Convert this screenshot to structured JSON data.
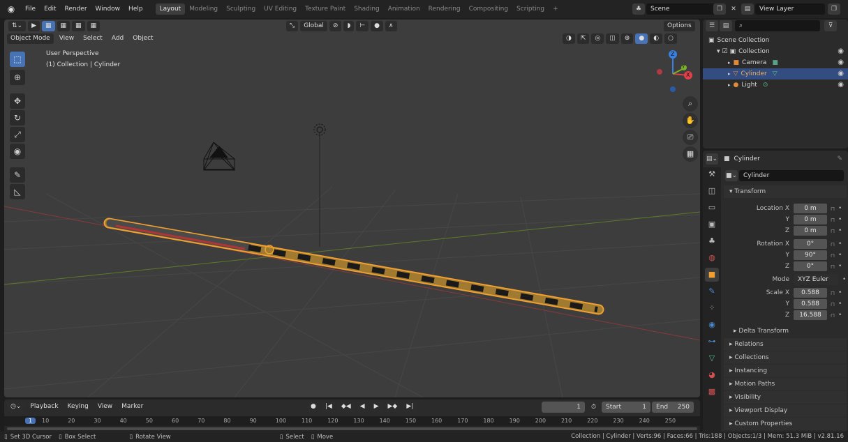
{
  "menu": [
    "File",
    "Edit",
    "Render",
    "Window",
    "Help"
  ],
  "workspaces": [
    {
      "label": "Layout",
      "active": true
    },
    {
      "label": "Modeling"
    },
    {
      "label": "Sculpting"
    },
    {
      "label": "UV Editing"
    },
    {
      "label": "Texture Paint"
    },
    {
      "label": "Shading"
    },
    {
      "label": "Animation"
    },
    {
      "label": "Rendering"
    },
    {
      "label": "Compositing"
    },
    {
      "label": "Scripting"
    }
  ],
  "add_workspace": "+",
  "scene": {
    "label": "Scene"
  },
  "view_layer": {
    "label": "View Layer"
  },
  "viewport": {
    "mode": "Object Mode",
    "menus": [
      "View",
      "Select",
      "Add",
      "Object"
    ],
    "orientation": "Global",
    "options": "Options",
    "overlay_title": "User Perspective",
    "overlay_subtitle": "(1) Collection | Cylinder",
    "gizmo": {
      "z": "Z",
      "x": "X",
      "y": "Y"
    }
  },
  "timeline": {
    "menus": [
      "Playback",
      "Keying",
      "View",
      "Marker"
    ],
    "current_frame": "1",
    "start_label": "Start",
    "start": "1",
    "end_label": "End",
    "end": "250",
    "ruler": [
      "1",
      "10",
      "20",
      "30",
      "40",
      "50",
      "60",
      "70",
      "80",
      "90",
      "100",
      "110",
      "120",
      "130",
      "140",
      "150",
      "160",
      "170",
      "180",
      "190",
      "200",
      "210",
      "220",
      "230",
      "240",
      "250"
    ]
  },
  "statusbar": {
    "left": [
      "Set 3D Cursor",
      "Box Select",
      "Rotate View",
      "Select",
      "Move"
    ],
    "right": "Collection | Cylinder | Verts:96 | Faces:66 | Tris:188 | Objects:1/3 | Mem: 51.3 MiB | v2.81.16"
  },
  "outliner": {
    "root": "Scene Collection",
    "collection": "Collection",
    "items": [
      {
        "label": "Camera",
        "selected": false
      },
      {
        "label": "Cylinder",
        "selected": true
      },
      {
        "label": "Light",
        "selected": false
      }
    ]
  },
  "properties": {
    "object_name": "Cylinder",
    "data_name": "Cylinder",
    "transform_title": "Transform",
    "location": {
      "label": "Location X",
      "x": "0 m",
      "y": "0 m",
      "z": "0 m"
    },
    "rotation": {
      "label": "Rotation X",
      "x": "0°",
      "y": "90°",
      "z": "0°"
    },
    "axis_y": "Y",
    "axis_z": "Z",
    "mode": {
      "label": "Mode",
      "value": "XYZ Euler"
    },
    "scale": {
      "label": "Scale X",
      "x": "0.588",
      "y": "0.588",
      "z": "16.588"
    },
    "panels": [
      "Delta Transform",
      "Relations",
      "Collections",
      "Instancing",
      "Motion Paths",
      "Visibility",
      "Viewport Display",
      "Custom Properties"
    ]
  },
  "colors": {
    "accent": "#4772b3",
    "selection": "#f0a030",
    "x_axis": "#e0404a",
    "y_axis": "#7ab32a",
    "z_axis": "#3a80e0"
  }
}
